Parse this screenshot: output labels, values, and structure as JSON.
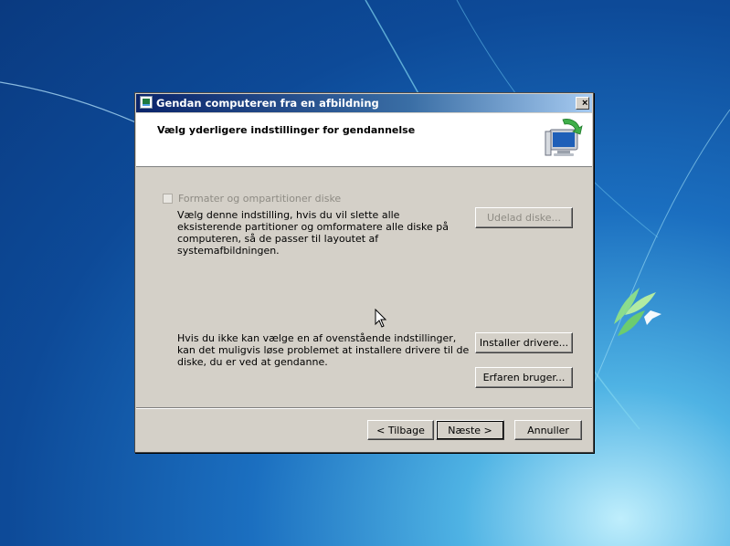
{
  "dialog": {
    "title": "Gendan computeren fra en afbildning",
    "close_label": "×",
    "header_title": "Vælg yderligere indstillinger for gendannelse",
    "format_option": {
      "label": "Formater og ompartitioner diske",
      "checked": false,
      "enabled": false,
      "description": "Vælg denne indstilling, hvis du vil slette alle eksisterende partitioner og omformatere alle diske på computeren, så de passer til layoutet af systemafbildningen."
    },
    "exclude_disks_label": "Udelad diske...",
    "driver_hint": "Hvis du ikke kan vælge en af ovenstående indstillinger, kan det muligvis løse problemet at installere drivere til de diske, du er ved at gendanne.",
    "install_drivers_label": "Installer drivere...",
    "advanced_label": "Erfaren bruger...",
    "back_label": "< Tilbage",
    "next_label": "Næste >",
    "cancel_label": "Annuller"
  },
  "icons": {
    "title": "restore-computer-icon",
    "header": "computer-restore-icon",
    "pointer": "mouse-pointer-icon"
  },
  "colors": {
    "dialog_bg": "#d4d0c8",
    "titlebar_start": "#0a246a",
    "titlebar_end": "#a6caf0",
    "desktop": "#1b6fc0"
  }
}
